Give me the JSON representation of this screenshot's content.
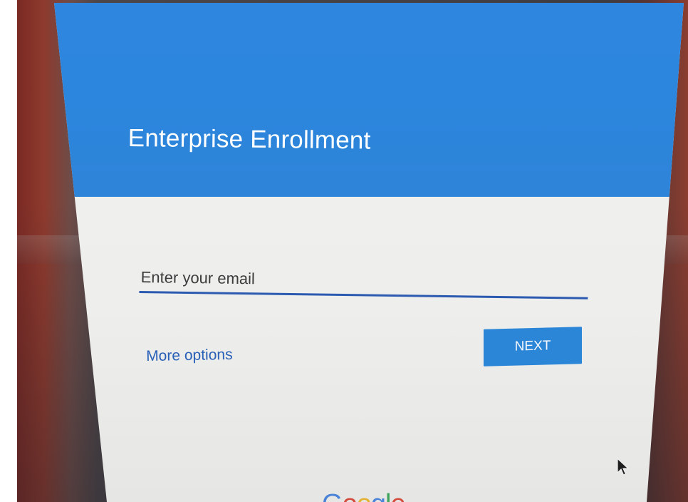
{
  "enrollment": {
    "title": "Enterprise Enrollment",
    "email_placeholder": "Enter your email",
    "more_options_label": "More options",
    "next_label": "NEXT"
  },
  "footer": {
    "logo_letters": [
      "G",
      "o",
      "o",
      "g",
      "l",
      "e"
    ]
  },
  "colors": {
    "header_blue": "#2d86dc",
    "link_blue": "#2860b8",
    "button_blue": "#2c86d8",
    "underline_blue": "#2b5ab0"
  }
}
